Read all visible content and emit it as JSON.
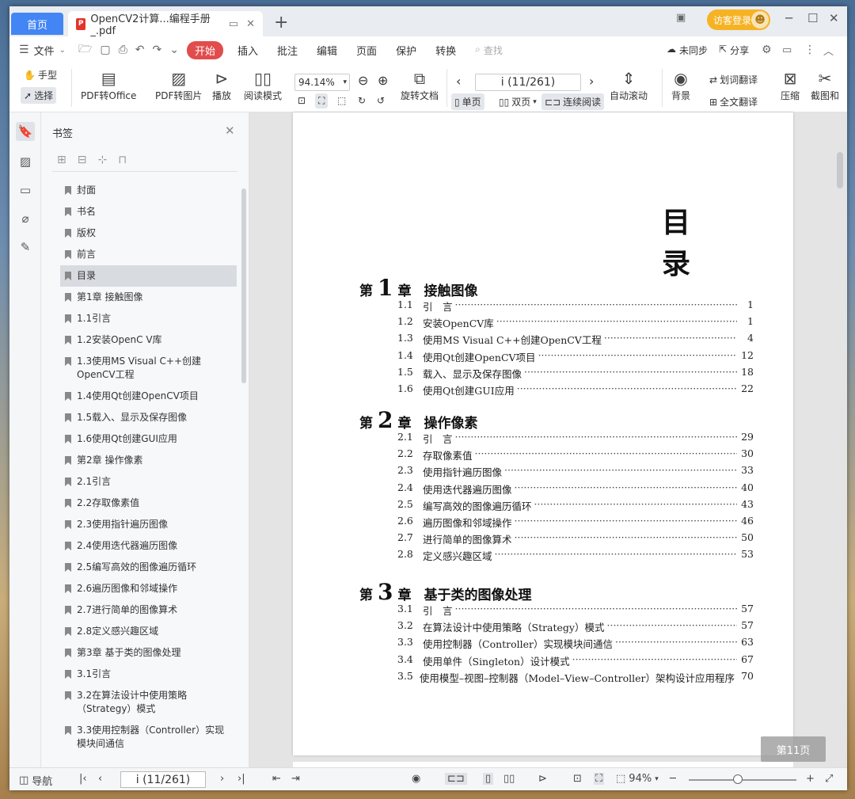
{
  "titlebar": {
    "home_tab": "首页",
    "doc_tab": "OpenCV2计算...编程手册_.pdf",
    "new_tab": "+",
    "guest_login": "访客登录"
  },
  "menubar": {
    "file": "文件",
    "start": "开始",
    "items": [
      "插入",
      "批注",
      "编辑",
      "页面",
      "保护",
      "转换"
    ],
    "search_placeholder": "查找",
    "unsynced": "未同步",
    "share": "分享"
  },
  "toolbar": {
    "hand": "手型",
    "select": "选择",
    "pdf_to_office": "PDF转Office",
    "pdf_to_image": "PDF转图片",
    "play": "播放",
    "read_mode": "阅读模式",
    "zoom": "94.14%",
    "rotate_doc": "旋转文档",
    "page_value": "i (11/261)",
    "single": "单页",
    "double": "双页",
    "continuous": "连续阅读",
    "auto_scroll": "自动滚动",
    "background": "背景",
    "word_translate": "划词翻译",
    "full_translate": "全文翻译",
    "compress": "压缩",
    "screenshot": "截图和"
  },
  "bookmarks": {
    "title": "书签",
    "items": [
      "封面",
      "书名",
      "版权",
      "前言",
      "目录",
      "第1章  接触图像",
      "1.1引言",
      "1.2安装OpenC V库",
      "1.3使用MS Visual C++创建OpenCV工程",
      "1.4使用Qt创建OpenCV项目",
      "1.5载入、显示及保存图像",
      "1.6使用Qt创建GUI应用",
      "第2章  操作像素",
      "2.1引言",
      "2.2存取像素值",
      "2.3使用指针遍历图像",
      "2.4使用迭代器遍历图像",
      "2.5编写高效的图像遍历循环",
      "2.6遍历图像和邻域操作",
      "2.7进行简单的图像算术",
      "2.8定义感兴趣区域",
      "第3章  基于类的图像处理",
      "3.1引言",
      "3.2在算法设计中使用策略（Strategy）模式",
      "3.3使用控制器（Controller）实现模块间通信"
    ],
    "active_index": 4
  },
  "doc": {
    "toc_title": "目 录",
    "chapters": [
      {
        "prefix": "第",
        "num": "1",
        "suffix": "章",
        "title": "接触图像",
        "entries": [
          {
            "n": "1.1",
            "t": "引　言",
            "p": "1"
          },
          {
            "n": "1.2",
            "t": "安装OpenCV库",
            "p": "1"
          },
          {
            "n": "1.3",
            "t": "使用MS Visual C++创建OpenCV工程",
            "p": "4"
          },
          {
            "n": "1.4",
            "t": "使用Qt创建OpenCV项目",
            "p": "12"
          },
          {
            "n": "1.5",
            "t": "载入、显示及保存图像",
            "p": "18"
          },
          {
            "n": "1.6",
            "t": "使用Qt创建GUI应用",
            "p": "22"
          }
        ]
      },
      {
        "prefix": "第",
        "num": "2",
        "suffix": "章",
        "title": "操作像素",
        "entries": [
          {
            "n": "2.1",
            "t": "引　言",
            "p": "29"
          },
          {
            "n": "2.2",
            "t": "存取像素值",
            "p": "30"
          },
          {
            "n": "2.3",
            "t": "使用指针遍历图像",
            "p": "33"
          },
          {
            "n": "2.4",
            "t": "使用迭代器遍历图像",
            "p": "40"
          },
          {
            "n": "2.5",
            "t": "编写高效的图像遍历循环",
            "p": "43"
          },
          {
            "n": "2.6",
            "t": "遍历图像和邻域操作",
            "p": "46"
          },
          {
            "n": "2.7",
            "t": "进行简单的图像算术",
            "p": "50"
          },
          {
            "n": "2.8",
            "t": "定义感兴趣区域",
            "p": "53"
          }
        ]
      },
      {
        "prefix": "第",
        "num": "3",
        "suffix": "章",
        "title": "基于类的图像处理",
        "entries": [
          {
            "n": "3.1",
            "t": "引　言",
            "p": "57"
          },
          {
            "n": "3.2",
            "t": "在算法设计中使用策略（Strategy）模式",
            "p": "57"
          },
          {
            "n": "3.3",
            "t": "使用控制器（Controller）实现模块间通信",
            "p": "63"
          },
          {
            "n": "3.4",
            "t": "使用单件（Singleton）设计模式",
            "p": "67"
          },
          {
            "n": "3.5",
            "t": "使用模型–视图–控制器（Model–View–Controller）架构设计应用程序",
            "p": "70"
          }
        ]
      }
    ],
    "page_badge": "第11页"
  },
  "status": {
    "nav": "导航",
    "page_value": "i (11/261)",
    "zoom": "94%"
  }
}
